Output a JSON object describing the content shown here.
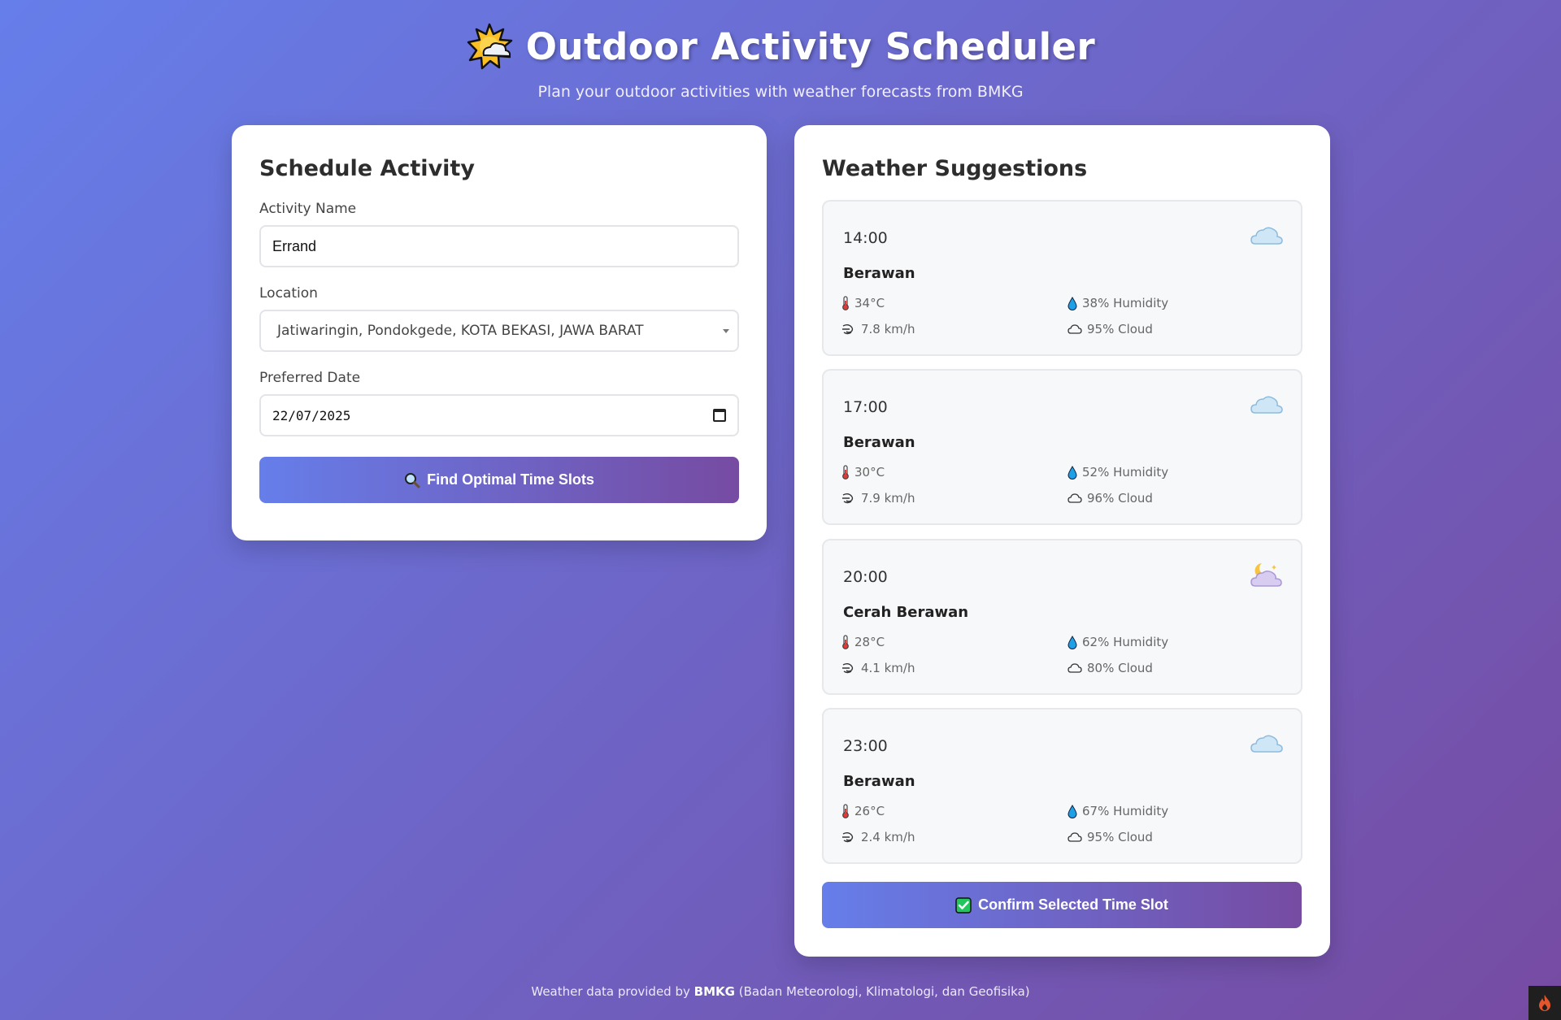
{
  "header": {
    "title": "Outdoor Activity Scheduler",
    "subtitle": "Plan your outdoor activities with weather forecasts from BMKG",
    "icon": "sun-behind-cloud-icon"
  },
  "schedule": {
    "heading": "Schedule Activity",
    "activity_label": "Activity Name",
    "activity_value": "Errand",
    "location_label": "Location",
    "location_value": "Jatiwaringin, Pondokgede, KOTA BEKASI, JAWA BARAT",
    "date_label": "Preferred Date",
    "date_value": "22/07/2025",
    "find_button": "Find Optimal Time Slots",
    "find_icon": "magnifier-icon"
  },
  "weather": {
    "heading": "Weather Suggestions",
    "slots": [
      {
        "time": "14:00",
        "condition": "Berawan",
        "temp": "34°C",
        "humidity": "38% Humidity",
        "wind": "7.8 km/h",
        "cloud": "95% Cloud",
        "icon": "cloud-icon"
      },
      {
        "time": "17:00",
        "condition": "Berawan",
        "temp": "30°C",
        "humidity": "52% Humidity",
        "wind": "7.9 km/h",
        "cloud": "96% Cloud",
        "icon": "cloud-icon"
      },
      {
        "time": "20:00",
        "condition": "Cerah Berawan",
        "temp": "28°C",
        "humidity": "62% Humidity",
        "wind": "4.1 km/h",
        "cloud": "80% Cloud",
        "icon": "moon-cloud-icon"
      },
      {
        "time": "23:00",
        "condition": "Berawan",
        "temp": "26°C",
        "humidity": "67% Humidity",
        "wind": "2.4 km/h",
        "cloud": "95% Cloud",
        "icon": "cloud-icon"
      }
    ],
    "confirm_button": "Confirm Selected Time Slot",
    "confirm_icon": "check-mark-icon"
  },
  "footer": {
    "prefix": "Weather data provided by",
    "brand": "BMKG",
    "suffix": "(Badan Meteorologi, Klimatologi, dan Geofisika)"
  },
  "colors": {
    "gradient_start": "#667eea",
    "gradient_end": "#764ba2",
    "card_bg": "#ffffff",
    "slot_bg": "#f7f8fa"
  }
}
